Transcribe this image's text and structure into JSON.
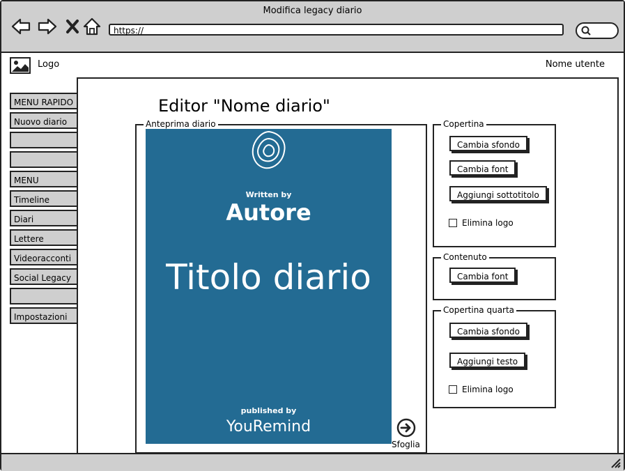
{
  "window": {
    "title": "Modifica legacy diario"
  },
  "browser": {
    "url": "https://"
  },
  "header": {
    "logo_label": "Logo",
    "user_name": "Nome utente"
  },
  "sidebar": {
    "quick_menu": [
      "MENU RAPIDO",
      "Nuovo diario",
      "",
      ""
    ],
    "menu": [
      "MENU",
      "Timeline",
      "Diari",
      "Lettere",
      "Videoracconti",
      "Social Legacy",
      "",
      "Impostazioni"
    ]
  },
  "editor": {
    "title": "Editor \"Nome diario\"",
    "preview_legend": "Anteprima diario",
    "next_label": "Sfoglia"
  },
  "cover": {
    "written_by": "Written by",
    "author": "Autore",
    "title": "Titolo diario",
    "published_by": "published by",
    "brand": "YouRemind",
    "bg_color": "#236b93"
  },
  "panels": {
    "copertina": {
      "legend": "Copertina",
      "btn_background": "Cambia sfondo",
      "btn_font": "Cambia font",
      "btn_subtitle": "Aggiungi sottotitolo",
      "chk_logo": "Elimina logo"
    },
    "contenuto": {
      "legend": "Contenuto",
      "btn_font": "Cambia font"
    },
    "copertina_quarta": {
      "legend": "Copertina quarta",
      "btn_background": "Cambia sfondo",
      "btn_text": "Aggiungi testo",
      "chk_logo": "Elimina logo"
    }
  }
}
